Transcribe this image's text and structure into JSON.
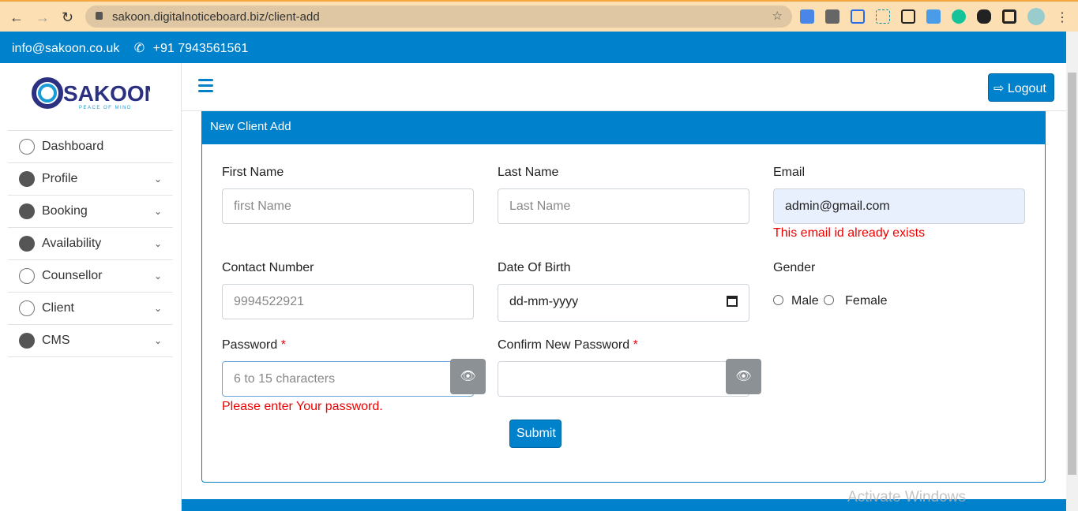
{
  "browser": {
    "url": "sakoon.digitalnoticeboard.biz/client-add"
  },
  "topbar": {
    "email": "info@sakoon.co.uk",
    "phone": "+91 7943561561"
  },
  "logo": {
    "name": "SAKOON",
    "tagline": "PEACE OF MIND"
  },
  "sidebar": {
    "items": [
      {
        "label": "Dashboard",
        "icon": "home-icon",
        "chevron": false
      },
      {
        "label": "Profile",
        "icon": "user-icon",
        "chevron": true
      },
      {
        "label": "Booking",
        "icon": "user-icon",
        "chevron": true
      },
      {
        "label": "Availability",
        "icon": "dashboard-icon",
        "chevron": true
      },
      {
        "label": "Counsellor",
        "icon": "clock-icon",
        "chevron": true
      },
      {
        "label": "Client",
        "icon": "clock-icon",
        "chevron": true
      },
      {
        "label": "CMS",
        "icon": "dashboard-icon",
        "chevron": true
      }
    ]
  },
  "header": {
    "logout": "Logout"
  },
  "form": {
    "title": "New Client Add",
    "first_name": {
      "label": "First Name",
      "placeholder": "first Name"
    },
    "last_name": {
      "label": "Last Name",
      "placeholder": "Last Name"
    },
    "email": {
      "label": "Email",
      "value": "admin@gmail.com",
      "error": "This email id already exists"
    },
    "contact": {
      "label": "Contact Number",
      "placeholder": "9994522921"
    },
    "dob": {
      "label": "Date Of Birth",
      "placeholder": "dd-mm-yyyy"
    },
    "gender": {
      "label": "Gender",
      "options": [
        "Male",
        "Female"
      ]
    },
    "password": {
      "label": "Password",
      "required": "*",
      "placeholder": "6 to 15 characters",
      "error": "Please enter Your password."
    },
    "confirm": {
      "label": "Confirm New Password",
      "required": "*"
    },
    "submit": "Submit"
  },
  "watermark": "Activate Windows",
  "colors": {
    "primary": "#0081cb",
    "error": "#e00000"
  }
}
